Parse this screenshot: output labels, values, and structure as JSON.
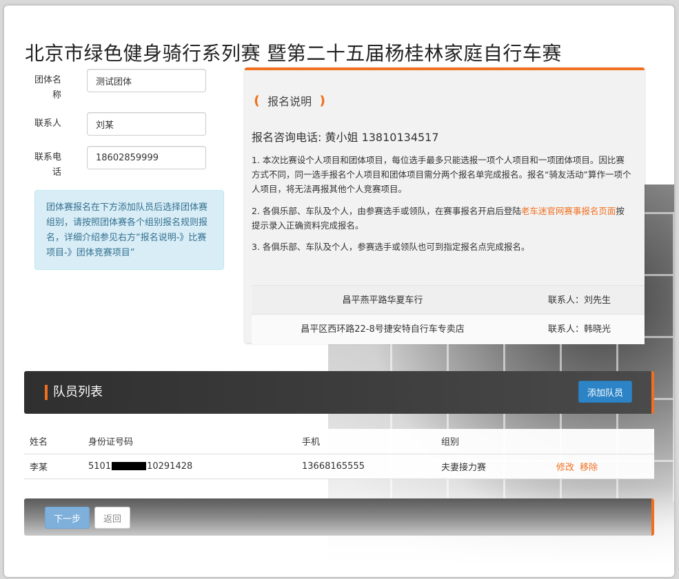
{
  "page": {
    "title": "北京市绿色健身骑行系列赛 暨第二十五届杨桂林家庭自行车赛"
  },
  "form": {
    "team_name_label_1": "团体名",
    "team_name_label_2": "称",
    "team_name_value": "测试团体",
    "contact_label": "联系人",
    "contact_value": "刘某",
    "phone_label_1": "联系电",
    "phone_label_2": "话",
    "phone_value": "18602859999",
    "notice": "团体赛报名在下方添加队员后选择团体赛组别，请按照团体赛各个组别报名规则报名，详细介绍参见右方“报名说明-》比赛项目-》团体竞赛项目”"
  },
  "registration": {
    "heading": "报名说明",
    "phone_line": "报名咨询电话: 黄小姐 13810134517",
    "para1": "1. 本次比赛设个人项目和团体项目，每位选手最多只能选报一项个人项目和一项团体项目。因比赛方式不同，同一选手报名个人项目和团体项目需分两个报名单完成报名。报名“骑友活动”算作一项个人项目，将无法再报其他个人竞赛项目。",
    "para2_pre": "2. 各俱乐部、车队及个人，由参赛选手或领队，在赛事报名开启后登陆",
    "para2_link": "老车迷官网赛事报名页面",
    "para2_post": "按提示录入正确资料完成报名。",
    "para3": "3. 各俱乐部、车队及个人，参赛选手或领队也可到指定报名点完成报名。",
    "stores": [
      {
        "name": "昌平燕平路华夏车行",
        "contact": "联系人：刘先生"
      },
      {
        "name": "昌平区西环路22-8号捷安特自行车专卖店",
        "contact": "联系人：韩晓光"
      }
    ]
  },
  "team": {
    "title": "队员列表",
    "add_button": "添加队员",
    "columns": [
      "姓名",
      "身份证号码",
      "手机",
      "组别",
      ""
    ],
    "rows": [
      {
        "name": "李某",
        "id_prefix": "5101",
        "id_suffix": "10291428",
        "phone": "13668165555",
        "group": "夫妻接力赛",
        "edit": "修改",
        "remove": "移除"
      }
    ]
  },
  "actions": {
    "next": "下一步",
    "back": "返回"
  },
  "colors": {
    "accent": "#f07020",
    "primary_button": "#2c84c6",
    "info_bg": "#d9edf7"
  }
}
